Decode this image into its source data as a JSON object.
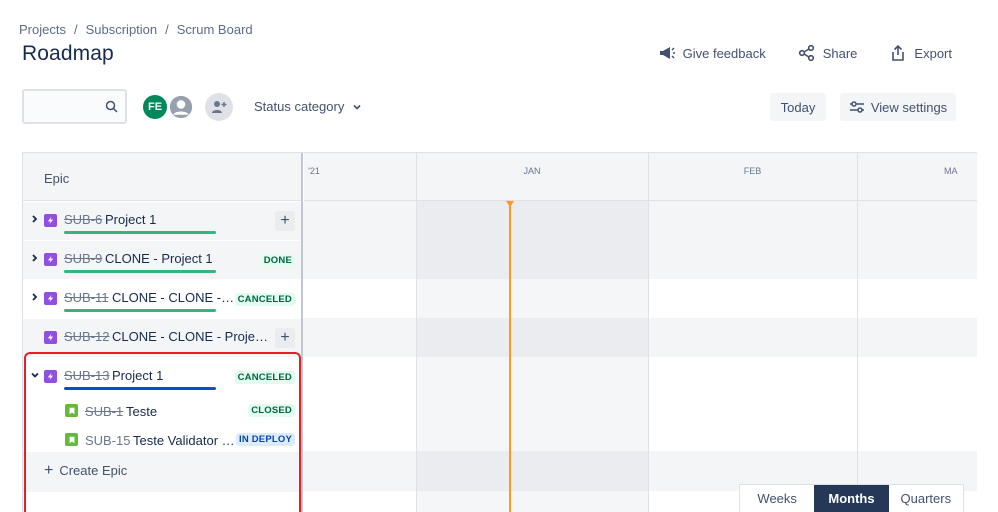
{
  "breadcrumb": [
    "Projects",
    "Subscription",
    "Scrum Board"
  ],
  "breadcrumb_sep": "/",
  "page_title": "Roadmap",
  "header_actions": {
    "feedback": "Give feedback",
    "share": "Share",
    "export": "Export"
  },
  "toolbar": {
    "search_placeholder": "",
    "avatar_initials": "FE",
    "status_category": "Status category",
    "today": "Today",
    "view_settings": "View settings"
  },
  "roadmap": {
    "epic_header": "Epic",
    "months": [
      "'21",
      "JAN",
      "FEB",
      "MA"
    ],
    "rows": [
      {
        "key": "SUB-6",
        "title": "Project 1",
        "status": "",
        "expanded": false
      },
      {
        "key": "SUB-9",
        "title": "CLONE - Project 1",
        "status": "DONE",
        "expanded": false
      },
      {
        "key": "SUB-11",
        "title": "CLONE - CLONE - Pr...",
        "status": "CANCELED",
        "expanded": false
      },
      {
        "key": "SUB-12",
        "title": "CLONE - CLONE - Project 1",
        "status": "",
        "expanded": false
      },
      {
        "key": "SUB-13",
        "title": "Project 1",
        "status": "CANCELED",
        "expanded": true
      }
    ],
    "children": [
      {
        "key": "SUB-1",
        "title": "Teste",
        "status": "CLOSED"
      },
      {
        "key": "SUB-15",
        "title": "Teste Validator (s...",
        "status": "IN DEPLOY"
      }
    ],
    "create_epic": "Create Epic"
  },
  "period_switch": {
    "options": [
      "Weeks",
      "Months",
      "Quarters"
    ],
    "selected": "Months"
  },
  "colors": {
    "epic": "#904ee2",
    "story": "#63ba3c",
    "progress_green": "#36b37e",
    "progress_blue": "#0052cc",
    "today_marker": "#ff991f",
    "highlight": "#e4202c"
  }
}
